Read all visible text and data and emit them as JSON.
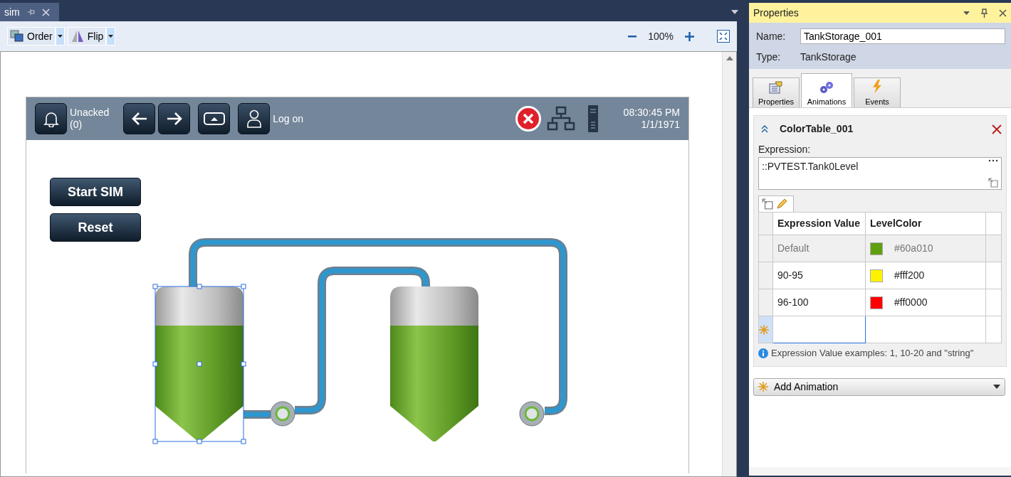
{
  "document_tab": {
    "title": "sim"
  },
  "toolbar": {
    "buttons": [
      {
        "label": "Order"
      },
      {
        "label": "Flip"
      }
    ],
    "zoom": "100%"
  },
  "hmi": {
    "alarm": {
      "label": "Unacked",
      "count": "(0)"
    },
    "user": {
      "label": "Log on"
    },
    "time": "08:30:45 PM",
    "date": "1/1/1971",
    "buttons": [
      {
        "label": "Start SIM"
      },
      {
        "label": "Reset"
      }
    ],
    "tanks": [
      {
        "selected": true
      },
      {
        "selected": false
      }
    ]
  },
  "properties": {
    "title": "Properties",
    "name_label": "Name:",
    "name_value": "TankStorage_001",
    "type_label": "Type:",
    "type_value": "TankStorage",
    "tabs": [
      {
        "label": "Properties",
        "selected": false
      },
      {
        "label": "Animations",
        "selected": true
      },
      {
        "label": "Events",
        "selected": false
      }
    ],
    "animation": {
      "title": "ColorTable_001",
      "expression_label": "Expression:",
      "expression": "::PVTEST.Tank0Level",
      "columns": [
        "Expression Value",
        "LevelColor"
      ],
      "rows": [
        {
          "value": "Default",
          "color_text": "#60a010",
          "color": "#60a010",
          "disabled": true
        },
        {
          "value": "90-95",
          "color_text": "#fff200",
          "color": "#fff200",
          "disabled": false
        },
        {
          "value": "96-100",
          "color_text": "#ff0000",
          "color": "#ff0000",
          "disabled": false
        }
      ],
      "hint": "Expression Value examples: 1, 10-20 and \"string\""
    },
    "add_button": "Add Animation"
  }
}
